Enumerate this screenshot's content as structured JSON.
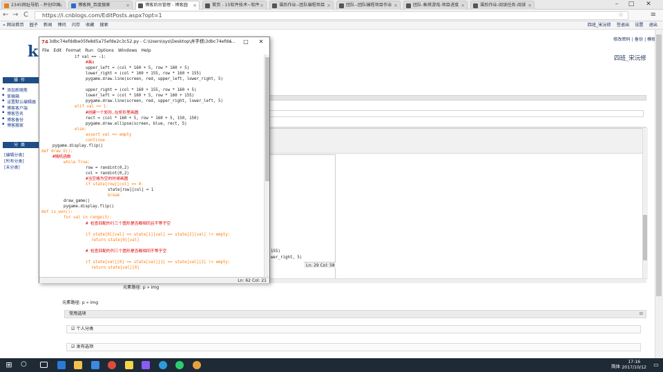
{
  "browser": {
    "tabs": [
      {
        "label": "2345网址导航 - 开创中国",
        "color": "#e67e22",
        "active": false
      },
      {
        "label": "博客网_百度搜索",
        "color": "#2b6cd4",
        "active": false
      },
      {
        "label": "博客后台管理 - 博客园",
        "color": "#555555",
        "active": true
      },
      {
        "label": "首页 - 15软件技术~软件",
        "color": "#555555",
        "active": false
      },
      {
        "label": "课后作业--团队编程项目",
        "color": "#555555",
        "active": false
      },
      {
        "label": "团队--团队编程项目作业",
        "color": "#555555",
        "active": false
      },
      {
        "label": "团队-象棋游戏-项目进度",
        "color": "#555555",
        "active": false
      },
      {
        "label": "课后作业-阅读任务-阅读",
        "color": "#555555",
        "active": false
      }
    ],
    "url": "https://i.cnblogs.com/EditPosts.aspx?opt=1",
    "back_icon": "←",
    "forward_icon": "→",
    "reload_icon": "C",
    "star_icon": "☆",
    "menu_icon": "≡",
    "minimize": "–",
    "maximize": "□",
    "close": "✕"
  },
  "cnbar": {
    "left": [
      "« 网站首页",
      "园子",
      "新闻",
      "博问",
      "闪存",
      "收藏",
      "搜索"
    ],
    "right": [
      "四班_宋沅修",
      "签退出",
      "设置",
      "退出"
    ]
  },
  "blog": {
    "top_links": "修改密码 | 备份 | 模板",
    "name": "四班_宋沅修",
    "logo_letter": "k",
    "operations_title": "操作",
    "operations": [
      "添加新随笔",
      "草稿箱",
      "设置默认编辑器",
      "博客客户端",
      "博客签名",
      "博客备份",
      "博客搬家"
    ],
    "category_title": "分类",
    "categories": [
      "[编辑分类]",
      "[所有分类]",
      "[未分类]"
    ],
    "element_path": "元素路径: p » img",
    "element_path2": "元素路径: p » img",
    "sections": [
      "常用选项",
      "个人分类",
      "发布选项"
    ],
    "inner_status": "Ln: 29 Col: 58",
    "editor_fragment_1": "155)",
    "editor_fragment_2": "wer_right, 5)"
  },
  "idle": {
    "title": "3dbc74efddbe05fe8d5a75efde2c3c52.py - C:\\Users\\sys\\Desktop\\井字棋\\3dbc74efdd...",
    "icon": "74",
    "menu": [
      "File",
      "Edit",
      "Format",
      "Run",
      "Options",
      "Windows",
      "Help"
    ],
    "status": "Ln: 62 Col: 21",
    "lines": [
      {
        "indent": 12,
        "text": "if val == -1:",
        "color": "#222222"
      },
      {
        "indent": 16,
        "text": "#画x",
        "color": "#dd0000"
      },
      {
        "indent": 16,
        "text": "upper_left = (col * 160 + 5, row * 160 + 5)",
        "color": "#222222"
      },
      {
        "indent": 16,
        "text": "lower_right = (col * 160 + 155, row * 160 + 155)",
        "color": "#222222"
      },
      {
        "indent": 16,
        "text": "pygame.draw.line(screen, red, upper_left, lower_right, 5)",
        "color": "#222222"
      },
      {
        "indent": 0,
        "text": "",
        "color": "#222222"
      },
      {
        "indent": 16,
        "text": "upper_right = (col * 160 + 155, row * 160 + 5)",
        "color": "#222222"
      },
      {
        "indent": 16,
        "text": "lower_left = (col * 160 + 5, row * 160 + 155)",
        "color": "#222222"
      },
      {
        "indent": 16,
        "text": "pygame.draw.line(screen, red, upper_right, lower_left, 5)",
        "color": "#222222"
      },
      {
        "indent": 12,
        "text": "elif val == 1:",
        "color": "#ff7700"
      },
      {
        "indent": 16,
        "text": "#创建一个矩形,在矩形里画圆",
        "color": "#dd0000"
      },
      {
        "indent": 16,
        "text": "rect = (col * 160 + 5, row * 160 + 5, 150, 150)",
        "color": "#222222"
      },
      {
        "indent": 16,
        "text": "pygame.draw.ellipse(screen, blue, rect, 5)",
        "color": "#222222"
      },
      {
        "indent": 12,
        "text": "else:",
        "color": "#ff7700"
      },
      {
        "indent": 16,
        "text": "assert val == empty",
        "color": "#ff7700"
      },
      {
        "indent": 16,
        "text": "continue",
        "color": "#ff7700"
      },
      {
        "indent": 4,
        "text": "pygame.display.flip()",
        "color": "#222222"
      },
      {
        "indent": 0,
        "text": "def draw_O():",
        "color": "#ff7700"
      },
      {
        "indent": 4,
        "text": "#随机函数",
        "color": "#dd0000"
      },
      {
        "indent": 8,
        "text": "while True:",
        "color": "#ff7700"
      },
      {
        "indent": 16,
        "text": "row = randint(0,2)",
        "color": "#222222"
      },
      {
        "indent": 16,
        "text": "col = randint(0,2)",
        "color": "#222222"
      },
      {
        "indent": 16,
        "text": "#当空格为空的时候画圆",
        "color": "#dd0000"
      },
      {
        "indent": 16,
        "text": "if state[row][col] == 0:",
        "color": "#ff7700"
      },
      {
        "indent": 24,
        "text": "state[row][col] = 1",
        "color": "#222222"
      },
      {
        "indent": 24,
        "text": "break",
        "color": "#ff7700"
      },
      {
        "indent": 8,
        "text": "draw_game()",
        "color": "#222222"
      },
      {
        "indent": 8,
        "text": "pygame.display.flip()",
        "color": "#222222"
      },
      {
        "indent": 0,
        "text": "def is_won():",
        "color": "#ff7700"
      },
      {
        "indent": 8,
        "text": "for val in range(3):",
        "color": "#ff7700"
      },
      {
        "indent": 16,
        "text": "# 检查四配的行三个图形是否都相同且不等于空",
        "color": "#dd0000"
      },
      {
        "indent": 0,
        "text": "",
        "color": "#222222"
      },
      {
        "indent": 16,
        "text": "if state[0][val] == state[1][val] == state[2][val] != empty:",
        "color": "#ff7700"
      },
      {
        "indent": 18,
        "text": "return state[0][val]",
        "color": "#ff7700"
      },
      {
        "indent": 0,
        "text": "",
        "color": "#222222"
      },
      {
        "indent": 16,
        "text": "# 检查四配的列三个图形是否都相同不等于空",
        "color": "#dd0000"
      },
      {
        "indent": 0,
        "text": "",
        "color": "#222222"
      },
      {
        "indent": 16,
        "text": "if state[val][0] == state[val][1] == state[val][2] != empty:",
        "color": "#ff7700"
      },
      {
        "indent": 18,
        "text": "return state[val][0]",
        "color": "#ff7700"
      }
    ]
  },
  "taskbar": {
    "start_icon": "⊞",
    "search_icon": "○",
    "apps": [
      {
        "name": "task-view-icon",
        "color": "#ffffff"
      },
      {
        "name": "edge-icon",
        "color": "#2b7bd6"
      },
      {
        "name": "file-explorer-icon",
        "color": "#f2c14e"
      },
      {
        "name": "store-icon",
        "color": "#3c8ae0"
      },
      {
        "name": "chrome-icon",
        "color": "#e04a3a"
      },
      {
        "name": "idle-icon",
        "color": "#f5d547"
      },
      {
        "name": "app-gem-icon",
        "color": "#8b5cf6"
      },
      {
        "name": "qq-browser-icon",
        "color": "#2d9cdb"
      },
      {
        "name": "green-app-icon",
        "color": "#2ecc71"
      },
      {
        "name": "chrome2-icon",
        "color": "#e6a23c"
      }
    ],
    "lang": "简体",
    "time": "17:16",
    "date": "2017/10/12",
    "notification_icon": "▭"
  }
}
